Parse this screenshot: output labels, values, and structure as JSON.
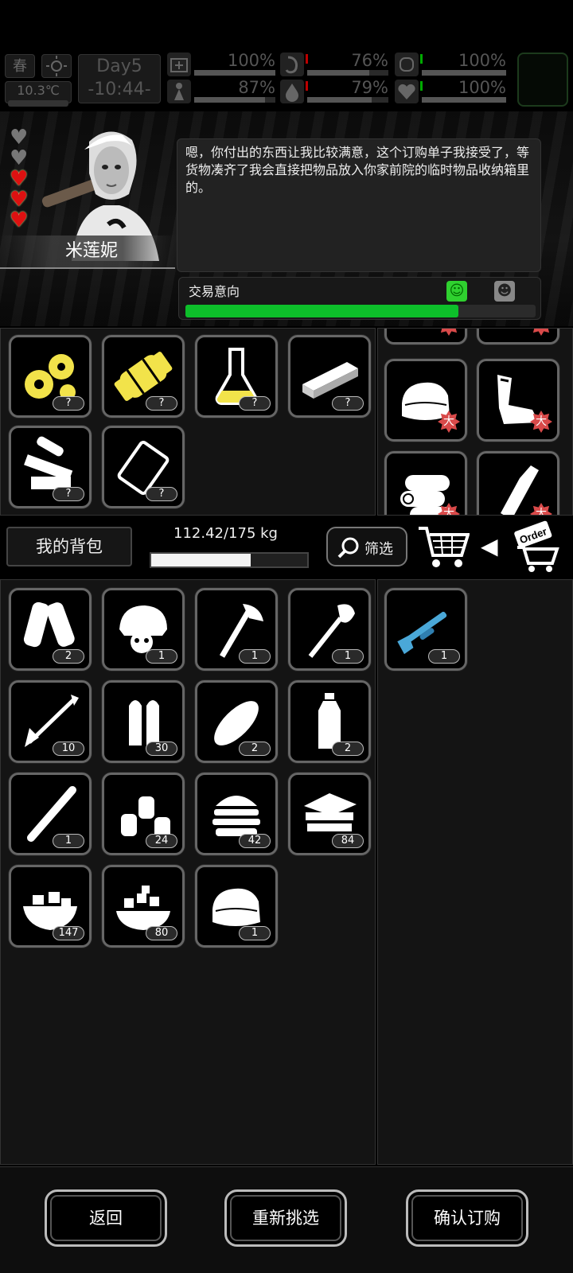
{
  "status": {
    "season": "春",
    "temperature": "10.3℃",
    "day": "Day5",
    "time": "-10:44-",
    "gauges": [
      {
        "name": "health",
        "value": "100%",
        "fill": 1.0
      },
      {
        "name": "hunger",
        "value": "76%",
        "fill": 0.76
      },
      {
        "name": "mood",
        "value": "100%",
        "fill": 1.0
      },
      {
        "name": "energy",
        "value": "87%",
        "fill": 0.87
      },
      {
        "name": "thirst",
        "value": "79%",
        "fill": 0.79
      },
      {
        "name": "heart",
        "value": "100%",
        "fill": 1.0
      }
    ]
  },
  "npc": {
    "name": "米莲妮",
    "hearts": {
      "empty": 2,
      "full": 3
    },
    "dialog": "嗯，你付出的东西让我比较满意，这个订购单子我接受了，等货物凑齐了我会直接把物品放入你家前院的临时物品收纳箱里的。",
    "trade_label": "交易意向",
    "trade_level": 0.78
  },
  "request_items": [
    {
      "icon": "gears-icon",
      "count": "?"
    },
    {
      "icon": "hydrant-icon",
      "count": "?"
    },
    {
      "icon": "flask-icon",
      "count": "?"
    },
    {
      "icon": "plank-icon",
      "count": "?"
    },
    {
      "icon": "parts-icon",
      "count": "?"
    },
    {
      "icon": "bag-icon",
      "count": "?"
    }
  ],
  "offer_items": [
    {
      "icon": "cloth-icon",
      "badge": "大"
    },
    {
      "icon": "bandage-icon",
      "badge": "大"
    },
    {
      "icon": "folded-cloth-icon",
      "badge": "大"
    },
    {
      "icon": "leg-brace-icon",
      "badge": "大"
    },
    {
      "icon": "logs-icon",
      "badge": "大"
    },
    {
      "icon": "bottle-icon",
      "badge": "大"
    }
  ],
  "backpack": {
    "label": "我的背包",
    "weight": "112.42/175 kg",
    "weight_fill": 0.64,
    "filter_label": "筛选",
    "order_text": "Order"
  },
  "my_items": [
    {
      "icon": "shin-guards-icon",
      "count": "2"
    },
    {
      "icon": "helmet-icon",
      "count": "1"
    },
    {
      "icon": "axe-icon",
      "count": "1"
    },
    {
      "icon": "shovel-icon",
      "count": "1"
    },
    {
      "icon": "arrow-icon",
      "count": "10"
    },
    {
      "icon": "bullets-icon",
      "count": "30"
    },
    {
      "icon": "bread-icon",
      "count": "2"
    },
    {
      "icon": "water-bottle-icon",
      "count": "2"
    },
    {
      "icon": "stick-icon",
      "count": "1"
    },
    {
      "icon": "bottles-icon",
      "count": "24"
    },
    {
      "icon": "burger-icon",
      "count": "42"
    },
    {
      "icon": "cloth-pile-icon",
      "count": "84"
    },
    {
      "icon": "food-bowl-icon",
      "count": "147"
    },
    {
      "icon": "sugar-bowl-icon",
      "count": "80"
    },
    {
      "icon": "folded-cloth-icon",
      "count": "1"
    }
  ],
  "selected_items": [
    {
      "icon": "shotgun-icon",
      "count": "1"
    }
  ],
  "footer": {
    "back": "返回",
    "reselect": "重新挑选",
    "confirm": "确认订购"
  }
}
